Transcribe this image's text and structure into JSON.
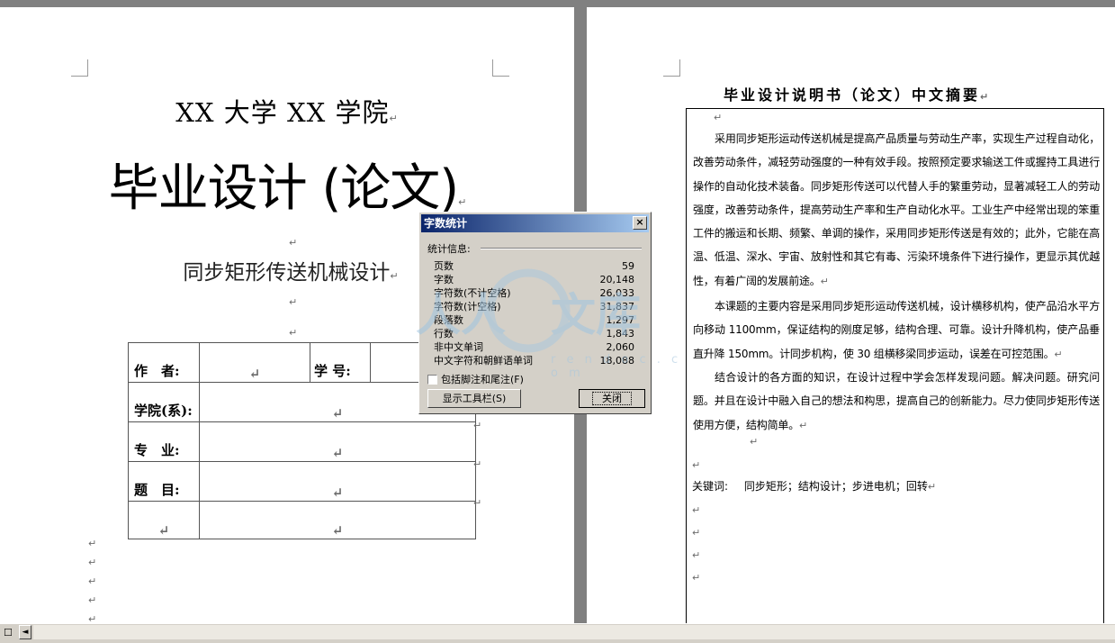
{
  "mark": "↵",
  "left_page": {
    "university": "XX 大学 XX 学院",
    "thesis_title": "毕业设计 (论文)",
    "topic": "同步矩形传送机械设计",
    "info_table": {
      "author_label": "作　者:",
      "student_id_label": "学 号:",
      "college_label": "学院(系):",
      "major_label": "专　业:",
      "subject_label": "题　目:"
    }
  },
  "right_page": {
    "abstract_title": "毕业设计说明书（论文）中文摘要",
    "paragraphs": [
      "采用同步矩形运动传送机械是提高产品质量与劳动生产率，实现生产过程自动化，改善劳动条件，减轻劳动强度的一种有效手段。按照预定要求输送工件或握持工具进行操作的自动化技术装备。同步矩形传送可以代替人手的繁重劳动，显著减轻工人的劳动强度，改善劳动条件，提高劳动生产率和生产自动化水平。工业生产中经常出现的笨重工件的搬运和长期、频繁、单调的操作，采用同步矩形传送是有效的；此外，它能在高温、低温、深水、宇宙、放射性和其它有毒、污染环境条件下进行操作，更显示其优越性，有着广阔的发展前途。",
      "本课题的主要内容是采用同步矩形运动传送机械，设计横移机构，使产品沿水平方向移动 1100mm，保证结构的刚度足够，结构合理、可靠。设计升降机构，使产品垂直升降 150mm。计同步机构，使 30 组横移梁同步运动，误差在可控范围。",
      "结合设计的各方面的知识，在设计过程中学会怎样发现问题。解决问题。研究问题。并且在设计中融入自己的想法和构思，提高自己的创新能力。尽力使同步矩形传送使用方便，结构简单。"
    ],
    "keywords_label": "关键词:",
    "keywords": "同步矩形；结构设计；步进电机；回转"
  },
  "dialog": {
    "title": "字数统计",
    "close_glyph": "×",
    "group_label": "统计信息:",
    "stats": [
      {
        "label": "页数",
        "value": "59"
      },
      {
        "label": "字数",
        "value": "20,148"
      },
      {
        "label": "字符数(不计空格)",
        "value": "26,033"
      },
      {
        "label": "字符数(计空格)",
        "value": "31,837"
      },
      {
        "label": "段落数",
        "value": "1,297"
      },
      {
        "label": "行数",
        "value": "1,843"
      },
      {
        "label": "非中文单词",
        "value": "2,060"
      },
      {
        "label": "中文字符和朝鲜语单词",
        "value": "18,088"
      }
    ],
    "checkbox_label": "包括脚注和尾注(F)",
    "toolbar_button": "显示工具栏(S)",
    "close_button": "关闭"
  },
  "watermark": {
    "text_left": "人人",
    "text_right": "文库",
    "sub": "r e n d o c . c o m"
  },
  "statusbar": {
    "view_icon": "☐",
    "scroll_left": "◄"
  }
}
